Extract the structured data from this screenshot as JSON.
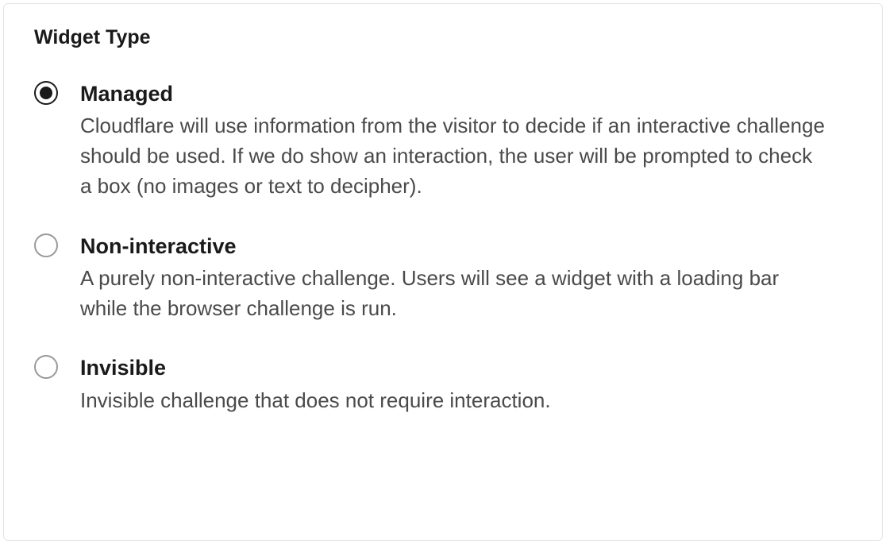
{
  "section": {
    "title": "Widget Type",
    "options": [
      {
        "id": "managed",
        "selected": true,
        "label": "Managed",
        "description": "Cloudflare will use information from the visitor to decide if an interactive challenge should be used. If we do show an interaction, the user will be prompted to check a box (no images or text to decipher)."
      },
      {
        "id": "non-interactive",
        "selected": false,
        "label": "Non-interactive",
        "description": "A purely non-interactive challenge. Users will see a widget with a loading bar while the browser challenge is run."
      },
      {
        "id": "invisible",
        "selected": false,
        "label": "Invisible",
        "description": "Invisible challenge that does not require interaction."
      }
    ]
  }
}
